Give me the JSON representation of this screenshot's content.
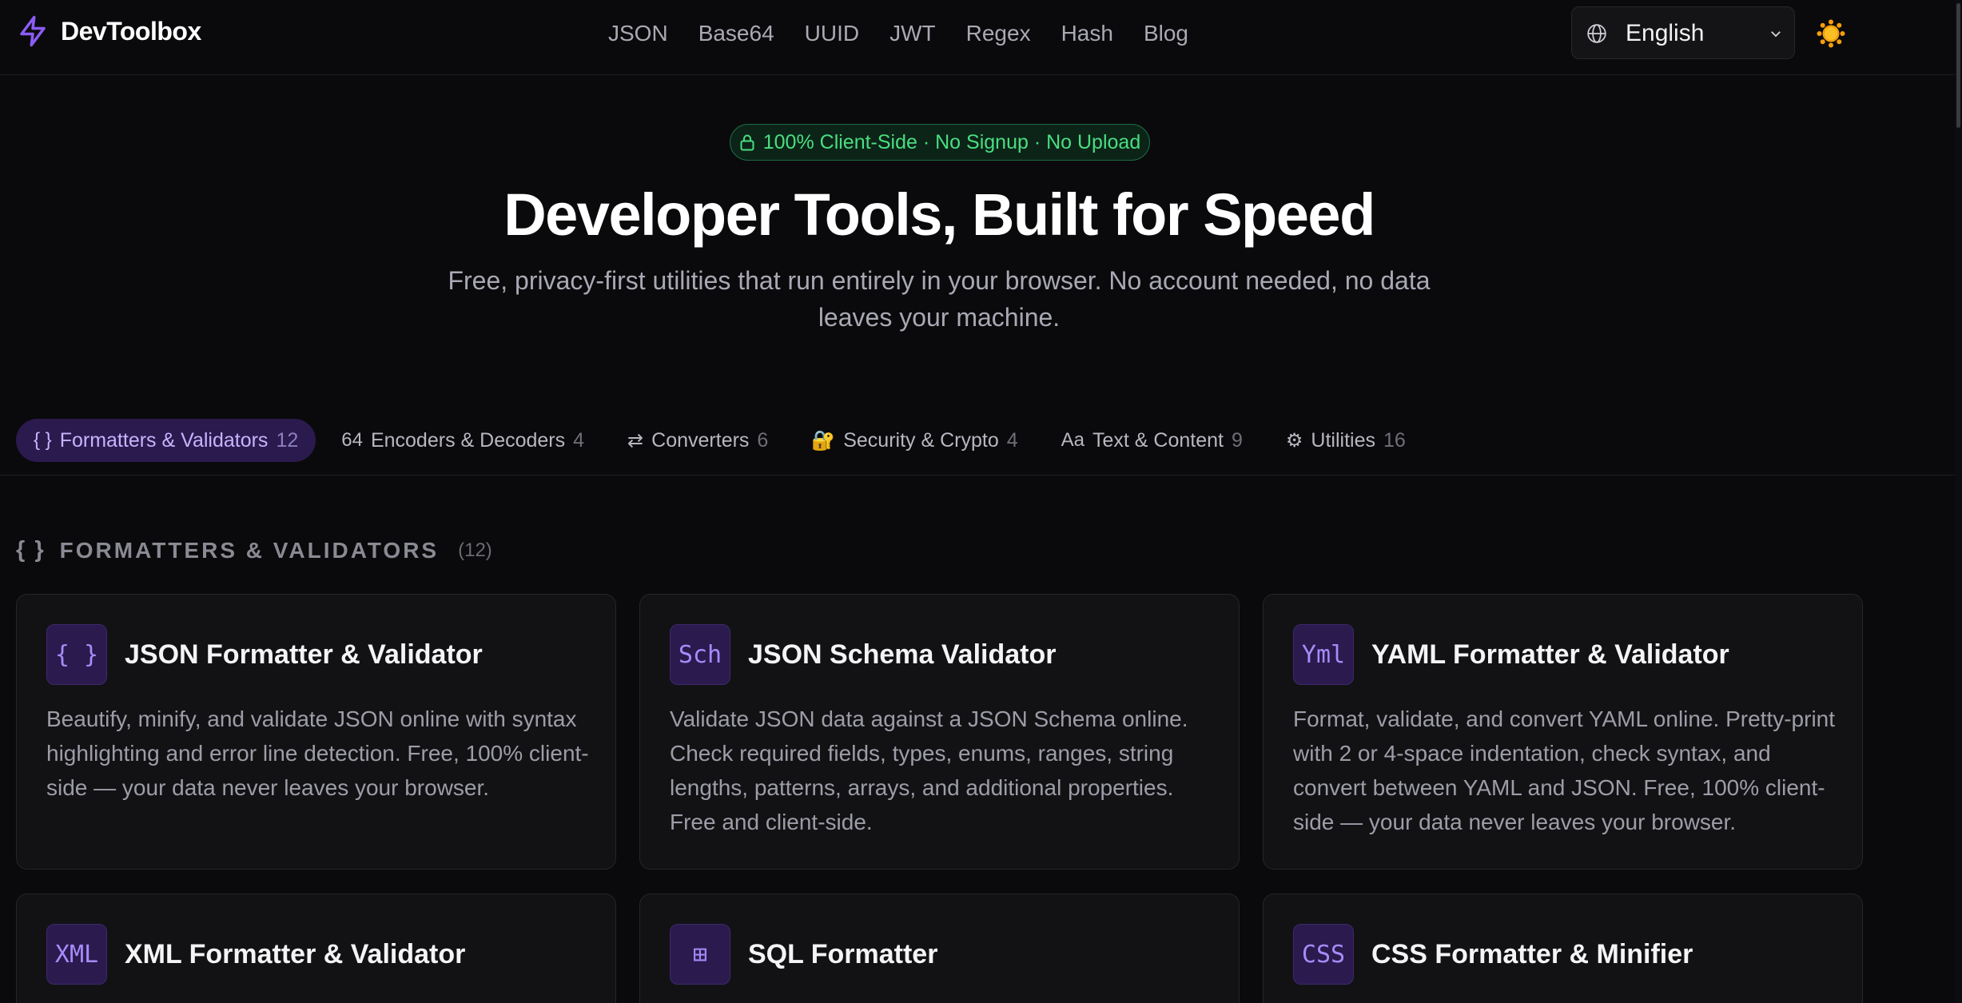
{
  "brand": {
    "name": "DevToolbox",
    "logo_icon": "lightning-bolt-icon",
    "accent": "#8b5cf6"
  },
  "nav": {
    "links": [
      "JSON",
      "Base64",
      "UUID",
      "JWT",
      "Regex",
      "Hash",
      "Blog"
    ]
  },
  "language": {
    "icon": "globe-icon",
    "selected": "English"
  },
  "theme": {
    "icon": "sun-icon"
  },
  "hero": {
    "badge": "100% Client-Side · No Signup · No Upload",
    "badge_color": "#4ade80",
    "title": "Developer Tools, Built for Speed",
    "subtitle": "Free, privacy-first utilities that run entirely in your browser. No account needed, no data leaves your machine."
  },
  "tabs": [
    {
      "icon": "{ }",
      "label": "Formatters & Validators",
      "count": "12",
      "active": true
    },
    {
      "icon": "64",
      "label": "Encoders & Decoders",
      "count": "4"
    },
    {
      "icon": "⇄",
      "label": "Converters",
      "count": "6"
    },
    {
      "icon": "🔐",
      "label": "Security & Crypto",
      "count": "4"
    },
    {
      "icon": "Aa",
      "label": "Text & Content",
      "count": "9"
    },
    {
      "icon": "⚙",
      "label": "Utilities",
      "count": "16"
    }
  ],
  "section": {
    "icon": "{ }",
    "title": "FORMATTERS & VALIDATORS",
    "count": "(12)"
  },
  "cards": [
    {
      "icon": "{ }",
      "title": "JSON Formatter & Validator",
      "description": "Beautify, minify, and validate JSON online with syntax highlighting and error line detection. Free, 100% client-side — your data never leaves your browser."
    },
    {
      "icon": "Sch",
      "title": "JSON Schema Validator",
      "description": "Validate JSON data against a JSON Schema online. Check required fields, types, enums, ranges, string lengths, patterns, arrays, and additional properties. Free and client-side."
    },
    {
      "icon": "Yml",
      "title": "YAML Formatter & Validator",
      "description": "Format, validate, and convert YAML online. Pretty-print with 2 or 4-space indentation, check syntax, and convert between YAML and JSON. Free, 100% client-side — your data never leaves your browser."
    },
    {
      "icon": "XML",
      "title": "XML Formatter & Validator"
    },
    {
      "icon": "⊞",
      "title": "SQL Formatter"
    },
    {
      "icon": "CSS",
      "title": "CSS Formatter & Minifier"
    }
  ]
}
